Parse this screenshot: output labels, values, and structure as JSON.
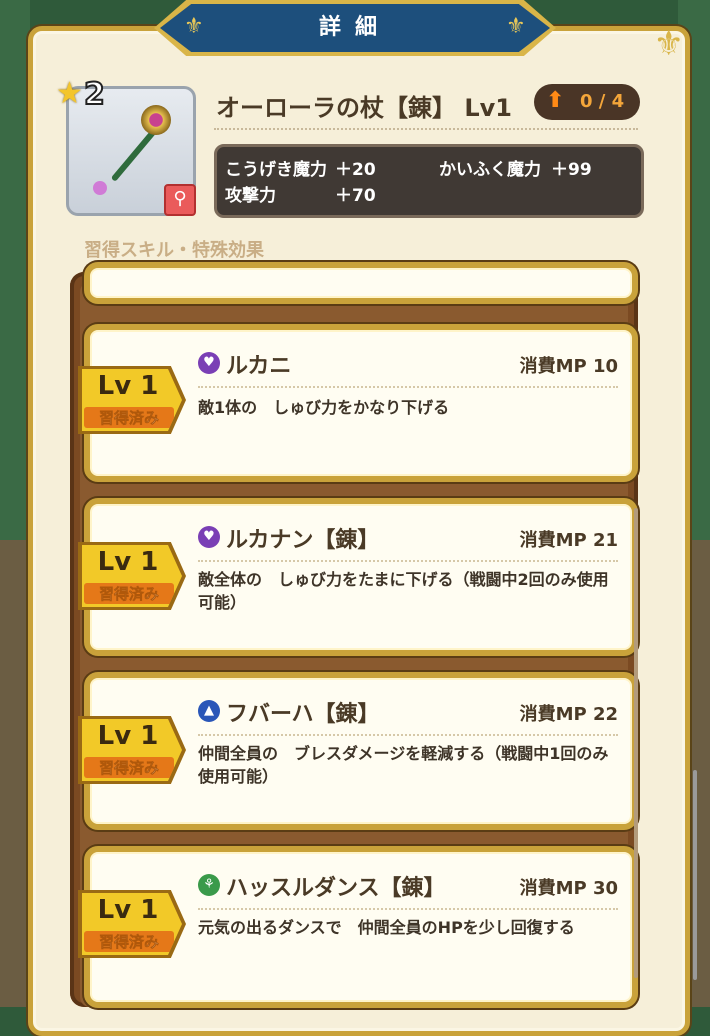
{
  "dialog": {
    "title": "詳細"
  },
  "item": {
    "rank": "2",
    "name": "オーローラの杖【錬】 Lv1",
    "upgrade": "0 / 4",
    "stats": [
      {
        "label": "こうげき魔力",
        "value": "＋20"
      },
      {
        "label": "かいふく魔力",
        "value": "＋99"
      },
      {
        "label": "攻撃力",
        "value": "＋70"
      }
    ]
  },
  "section_label": "習得スキル・特殊効果",
  "skills": [
    {
      "name": "ルカニ",
      "mp": "消費MP 10",
      "desc": "敵1体の　しゅび力をかなり下げる",
      "level": "Lv 1",
      "status": "習得済み",
      "icon": "purple-orb-icon",
      "icon_color": "#7a3fb5"
    },
    {
      "name": "ルカナン【錬】",
      "mp": "消費MP 21",
      "desc": "敵全体の　しゅび力をたまに下げる（戦闘中2回のみ使用可能）",
      "level": "Lv 1",
      "status": "習得済み",
      "icon": "purple-orb-icon",
      "icon_color": "#7a3fb5"
    },
    {
      "name": "フバーハ【錬】",
      "mp": "消費MP 22",
      "desc": "仲間全員の　ブレスダメージを軽減する（戦闘中1回のみ使用可能）",
      "level": "Lv 1",
      "status": "習得済み",
      "icon": "blue-orb-icon",
      "icon_color": "#2a56b8"
    },
    {
      "name": "ハッスルダンス【錬】",
      "mp": "消費MP 30",
      "desc": "元気の出るダンスで　仲間全員のHPを少し回復する",
      "level": "Lv 1",
      "status": "習得済み",
      "icon": "green-orb-icon",
      "icon_color": "#3a9a4a"
    }
  ],
  "colors": {
    "frame_gold": "#c9a23a",
    "title_blue": "#1d4f7c",
    "panel_cream": "#f6efd9",
    "badge_yellow": "#f2c928"
  }
}
